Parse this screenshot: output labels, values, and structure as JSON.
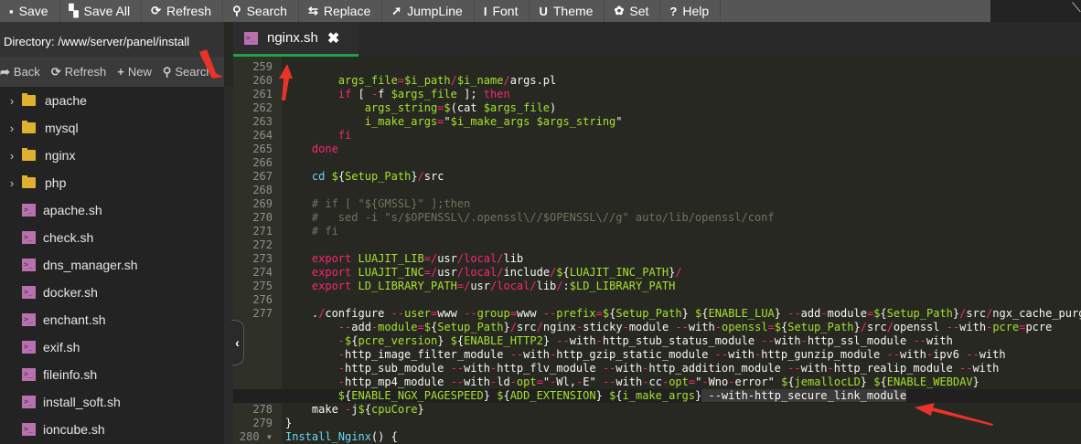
{
  "toolbar": {
    "items": [
      {
        "icon": "▪",
        "label": "Save"
      },
      {
        "icon": "▚",
        "label": "Save All"
      },
      {
        "icon": "⟳",
        "label": "Refresh"
      },
      {
        "icon": "⚲",
        "label": "Search"
      },
      {
        "icon": "⇆",
        "label": "Replace"
      },
      {
        "icon": "➚",
        "label": "JumpLine"
      },
      {
        "icon": "Ι",
        "label": "Font"
      },
      {
        "icon": "U",
        "label": "Theme"
      },
      {
        "icon": "✿",
        "label": "Set"
      },
      {
        "icon": "?",
        "label": "Help"
      }
    ]
  },
  "sidebar": {
    "directory": "Directory: /www/server/panel/install",
    "actions": [
      {
        "icon": "➦",
        "label": "Back"
      },
      {
        "icon": "⟳",
        "label": "Refresh"
      },
      {
        "icon": "+",
        "label": "New"
      },
      {
        "icon": "⚲",
        "label": "Search"
      }
    ],
    "files": [
      {
        "type": "folder",
        "name": "apache"
      },
      {
        "type": "folder",
        "name": "mysql"
      },
      {
        "type": "folder",
        "name": "nginx"
      },
      {
        "type": "folder",
        "name": "php"
      },
      {
        "type": "sh",
        "name": "apache.sh"
      },
      {
        "type": "sh",
        "name": "check.sh"
      },
      {
        "type": "sh",
        "name": "dns_manager.sh"
      },
      {
        "type": "sh",
        "name": "docker.sh"
      },
      {
        "type": "sh",
        "name": "enchant.sh"
      },
      {
        "type": "sh",
        "name": "exif.sh"
      },
      {
        "type": "sh",
        "name": "fileinfo.sh"
      },
      {
        "type": "sh",
        "name": "install_soft.sh"
      },
      {
        "type": "sh",
        "name": "ioncube.sh"
      }
    ]
  },
  "tab": {
    "label": "nginx.sh",
    "close": "✖",
    "icon": ">_"
  },
  "colors": {
    "accent": "#1fa34a",
    "keyword": "#f92672",
    "variable": "#a6e22e",
    "comment": "#75715e",
    "annotation": "#e8332a"
  },
  "code": [
    {
      "n": "259",
      "t": []
    },
    {
      "n": "260",
      "t": [
        [
          "w",
          "        "
        ],
        [
          "v",
          "args_file"
        ],
        [
          "p",
          "="
        ],
        [
          "v",
          "$i_path"
        ],
        [
          "p",
          "/"
        ],
        [
          "v",
          "$i_name"
        ],
        [
          "p",
          "/"
        ],
        [
          "w",
          "args.pl"
        ]
      ]
    },
    {
      "n": "261",
      "t": [
        [
          "w",
          "        "
        ],
        [
          "k",
          "if"
        ],
        [
          "w",
          " [ "
        ],
        [
          "p",
          "-"
        ],
        [
          "w",
          "f "
        ],
        [
          "v",
          "$args_file"
        ],
        [
          "w",
          " ]; "
        ],
        [
          "k",
          "then"
        ]
      ]
    },
    {
      "n": "262",
      "t": [
        [
          "w",
          "            "
        ],
        [
          "v",
          "args_string"
        ],
        [
          "p",
          "="
        ],
        [
          "v",
          "$"
        ],
        [
          "w",
          "(cat "
        ],
        [
          "v",
          "$args_file"
        ],
        [
          "w",
          ")"
        ]
      ]
    },
    {
      "n": "263",
      "t": [
        [
          "w",
          "            "
        ],
        [
          "v",
          "i_make_args"
        ],
        [
          "p",
          "="
        ],
        [
          "w",
          "\""
        ],
        [
          "v",
          "$i_make_args $args_string"
        ],
        [
          "w",
          "\""
        ]
      ]
    },
    {
      "n": "264",
      "t": [
        [
          "w",
          "        "
        ],
        [
          "k",
          "fi"
        ]
      ]
    },
    {
      "n": "265",
      "t": [
        [
          "w",
          "    "
        ],
        [
          "k",
          "done"
        ]
      ]
    },
    {
      "n": "266",
      "t": []
    },
    {
      "n": "267",
      "t": [
        [
          "w",
          "    "
        ],
        [
          "y",
          "cd"
        ],
        [
          "w",
          " "
        ],
        [
          "v",
          "$"
        ],
        [
          "w",
          "{"
        ],
        [
          "v",
          "Setup_Path"
        ],
        [
          "w",
          "}"
        ],
        [
          "p",
          "/"
        ],
        [
          "w",
          "src"
        ]
      ]
    },
    {
      "n": "268",
      "t": []
    },
    {
      "n": "269",
      "t": [
        [
          "c",
          "    # if [ \"${GMSSL}\" ];then"
        ]
      ]
    },
    {
      "n": "270",
      "t": [
        [
          "c",
          "    #   sed -i \"s/$OPENSSL\\/.openssl\\//$OPENSSL\\//g\" auto/lib/openssl/conf"
        ]
      ]
    },
    {
      "n": "271",
      "t": [
        [
          "c",
          "    # fi"
        ]
      ]
    },
    {
      "n": "272",
      "t": []
    },
    {
      "n": "273",
      "t": [
        [
          "w",
          "    "
        ],
        [
          "k",
          "export"
        ],
        [
          "w",
          " "
        ],
        [
          "v",
          "LUAJIT_LIB"
        ],
        [
          "p",
          "=/"
        ],
        [
          "w",
          "usr"
        ],
        [
          "p",
          "/local/"
        ],
        [
          "w",
          "lib"
        ]
      ]
    },
    {
      "n": "274",
      "t": [
        [
          "w",
          "    "
        ],
        [
          "k",
          "export"
        ],
        [
          "w",
          " "
        ],
        [
          "v",
          "LUAJIT_INC"
        ],
        [
          "p",
          "=/"
        ],
        [
          "w",
          "usr"
        ],
        [
          "p",
          "/local/"
        ],
        [
          "w",
          "include"
        ],
        [
          "p",
          "/"
        ],
        [
          "v",
          "$"
        ],
        [
          "w",
          "{"
        ],
        [
          "v",
          "LUAJIT_INC_PATH"
        ],
        [
          "w",
          "}"
        ],
        [
          "p",
          "/"
        ]
      ]
    },
    {
      "n": "275",
      "t": [
        [
          "w",
          "    "
        ],
        [
          "k",
          "export"
        ],
        [
          "w",
          " "
        ],
        [
          "v",
          "LD_LIBRARY_PATH"
        ],
        [
          "p",
          "=/"
        ],
        [
          "w",
          "usr"
        ],
        [
          "p",
          "/local/"
        ],
        [
          "w",
          "lib"
        ],
        [
          "p",
          "/"
        ],
        [
          "w",
          ":"
        ],
        [
          "v",
          "$LD_LIBRARY_PATH"
        ]
      ]
    },
    {
      "n": "276",
      "t": []
    },
    {
      "n": "277",
      "t": [
        [
          "w",
          "    ."
        ],
        [
          "p",
          "/"
        ],
        [
          "w",
          "configure "
        ],
        [
          "p",
          "--"
        ],
        [
          "v",
          "user"
        ],
        [
          "p",
          "="
        ],
        [
          "w",
          "www "
        ],
        [
          "p",
          "--"
        ],
        [
          "v",
          "group"
        ],
        [
          "p",
          "="
        ],
        [
          "w",
          "www "
        ],
        [
          "p",
          "--"
        ],
        [
          "v",
          "prefix"
        ],
        [
          "p",
          "="
        ],
        [
          "v",
          "$"
        ],
        [
          "w",
          "{"
        ],
        [
          "v",
          "Setup_Path"
        ],
        [
          "w",
          "} "
        ],
        [
          "v",
          "$"
        ],
        [
          "w",
          "{"
        ],
        [
          "v",
          "ENABLE_LUA"
        ],
        [
          "w",
          "} "
        ],
        [
          "p",
          "--"
        ],
        [
          "w",
          "add"
        ],
        [
          "p",
          "-"
        ],
        [
          "w",
          "module"
        ],
        [
          "p",
          "="
        ],
        [
          "v",
          "$"
        ],
        [
          "w",
          "{"
        ],
        [
          "v",
          "Setup_Path"
        ],
        [
          "w",
          "}"
        ],
        [
          "p",
          "/"
        ],
        [
          "w",
          "src"
        ],
        [
          "p",
          "/"
        ],
        [
          "w",
          "ngx_cache_purge"
        ]
      ]
    },
    {
      "n": "",
      "t": [
        [
          "w",
          "        "
        ],
        [
          "p",
          "--"
        ],
        [
          "w",
          "add"
        ],
        [
          "p",
          "-"
        ],
        [
          "v",
          "module"
        ],
        [
          "p",
          "="
        ],
        [
          "v",
          "$"
        ],
        [
          "w",
          "{"
        ],
        [
          "v",
          "Setup_Path"
        ],
        [
          "w",
          "}"
        ],
        [
          "p",
          "/"
        ],
        [
          "w",
          "src"
        ],
        [
          "p",
          "/"
        ],
        [
          "w",
          "nginx"
        ],
        [
          "p",
          "-"
        ],
        [
          "w",
          "sticky"
        ],
        [
          "p",
          "-"
        ],
        [
          "w",
          "module "
        ],
        [
          "p",
          "--"
        ],
        [
          "w",
          "with"
        ],
        [
          "p",
          "-"
        ],
        [
          "v",
          "openssl"
        ],
        [
          "p",
          "="
        ],
        [
          "v",
          "$"
        ],
        [
          "w",
          "{"
        ],
        [
          "v",
          "Setup_Path"
        ],
        [
          "w",
          "}"
        ],
        [
          "p",
          "/"
        ],
        [
          "w",
          "src"
        ],
        [
          "p",
          "/"
        ],
        [
          "w",
          "openssl "
        ],
        [
          "p",
          "--"
        ],
        [
          "w",
          "with"
        ],
        [
          "p",
          "-"
        ],
        [
          "v",
          "pcre"
        ],
        [
          "p",
          "="
        ],
        [
          "w",
          "pcre"
        ]
      ]
    },
    {
      "n": "",
      "t": [
        [
          "w",
          "        "
        ],
        [
          "p",
          "-"
        ],
        [
          "v",
          "$"
        ],
        [
          "w",
          "{"
        ],
        [
          "v",
          "pcre_version"
        ],
        [
          "w",
          "} "
        ],
        [
          "v",
          "$"
        ],
        [
          "w",
          "{"
        ],
        [
          "v",
          "ENABLE_HTTP2"
        ],
        [
          "w",
          "} "
        ],
        [
          "p",
          "--"
        ],
        [
          "w",
          "with"
        ],
        [
          "p",
          "-"
        ],
        [
          "w",
          "http_stub_status_module "
        ],
        [
          "p",
          "--"
        ],
        [
          "w",
          "with"
        ],
        [
          "p",
          "-"
        ],
        [
          "w",
          "http_ssl_module "
        ],
        [
          "p",
          "--"
        ],
        [
          "w",
          "with"
        ]
      ]
    },
    {
      "n": "",
      "t": [
        [
          "w",
          "        "
        ],
        [
          "p",
          "-"
        ],
        [
          "w",
          "http_image_filter_module "
        ],
        [
          "p",
          "--"
        ],
        [
          "w",
          "with"
        ],
        [
          "p",
          "-"
        ],
        [
          "w",
          "http_gzip_static_module "
        ],
        [
          "p",
          "--"
        ],
        [
          "w",
          "with"
        ],
        [
          "p",
          "-"
        ],
        [
          "w",
          "http_gunzip_module "
        ],
        [
          "p",
          "--"
        ],
        [
          "w",
          "with"
        ],
        [
          "p",
          "-"
        ],
        [
          "w",
          "ipv6 "
        ],
        [
          "p",
          "--"
        ],
        [
          "w",
          "with"
        ]
      ]
    },
    {
      "n": "",
      "t": [
        [
          "w",
          "        "
        ],
        [
          "p",
          "-"
        ],
        [
          "w",
          "http_sub_module "
        ],
        [
          "p",
          "--"
        ],
        [
          "w",
          "with"
        ],
        [
          "p",
          "-"
        ],
        [
          "w",
          "http_flv_module "
        ],
        [
          "p",
          "--"
        ],
        [
          "w",
          "with"
        ],
        [
          "p",
          "-"
        ],
        [
          "w",
          "http_addition_module "
        ],
        [
          "p",
          "--"
        ],
        [
          "w",
          "with"
        ],
        [
          "p",
          "-"
        ],
        [
          "w",
          "http_realip_module "
        ],
        [
          "p",
          "--"
        ],
        [
          "w",
          "with"
        ]
      ]
    },
    {
      "n": "",
      "t": [
        [
          "w",
          "        "
        ],
        [
          "p",
          "-"
        ],
        [
          "w",
          "http_mp4_module "
        ],
        [
          "p",
          "--"
        ],
        [
          "w",
          "with"
        ],
        [
          "p",
          "-"
        ],
        [
          "w",
          "ld"
        ],
        [
          "p",
          "-"
        ],
        [
          "v",
          "opt"
        ],
        [
          "p",
          "="
        ],
        [
          "w",
          "\""
        ],
        [
          "p",
          "-"
        ],
        [
          "w",
          "Wl,"
        ],
        [
          "p",
          "-"
        ],
        [
          "w",
          "E\" "
        ],
        [
          "p",
          "--"
        ],
        [
          "w",
          "with"
        ],
        [
          "p",
          "-"
        ],
        [
          "w",
          "cc"
        ],
        [
          "p",
          "-"
        ],
        [
          "v",
          "opt"
        ],
        [
          "p",
          "="
        ],
        [
          "w",
          "\""
        ],
        [
          "p",
          "-"
        ],
        [
          "w",
          "Wno"
        ],
        [
          "p",
          "-"
        ],
        [
          "w",
          "error\" "
        ],
        [
          "v",
          "$"
        ],
        [
          "w",
          "{"
        ],
        [
          "v",
          "jemallocLD"
        ],
        [
          "w",
          "} "
        ],
        [
          "v",
          "$"
        ],
        [
          "w",
          "{"
        ],
        [
          "v",
          "ENABLE_WEBDAV"
        ],
        [
          "w",
          "}"
        ]
      ]
    },
    {
      "n": "",
      "active": true,
      "t": [
        [
          "w",
          "        "
        ],
        [
          "v",
          "$"
        ],
        [
          "w",
          "{"
        ],
        [
          "v",
          "ENABLE_NGX_PAGESPEED"
        ],
        [
          "w",
          "} "
        ],
        [
          "v",
          "$"
        ],
        [
          "w",
          "{"
        ],
        [
          "v",
          "ADD_EXTENSION"
        ],
        [
          "w",
          "} "
        ],
        [
          "v",
          "$"
        ],
        [
          "w",
          "{"
        ],
        [
          "v",
          "i_make_args"
        ],
        [
          "w",
          "}"
        ],
        [
          "h",
          " --with-http_secure_link_module"
        ]
      ]
    },
    {
      "n": "278",
      "t": [
        [
          "w",
          "    make "
        ],
        [
          "p",
          "-"
        ],
        [
          "w",
          "j"
        ],
        [
          "v",
          "$"
        ],
        [
          "w",
          "{"
        ],
        [
          "v",
          "cpuCore"
        ],
        [
          "w",
          "}"
        ]
      ]
    },
    {
      "n": "279",
      "t": [
        [
          "w",
          "}"
        ]
      ]
    },
    {
      "n": "280 ▾",
      "t": [
        [
          "y",
          "Install_Nginx"
        ],
        [
          "w",
          "() {"
        ]
      ]
    }
  ]
}
